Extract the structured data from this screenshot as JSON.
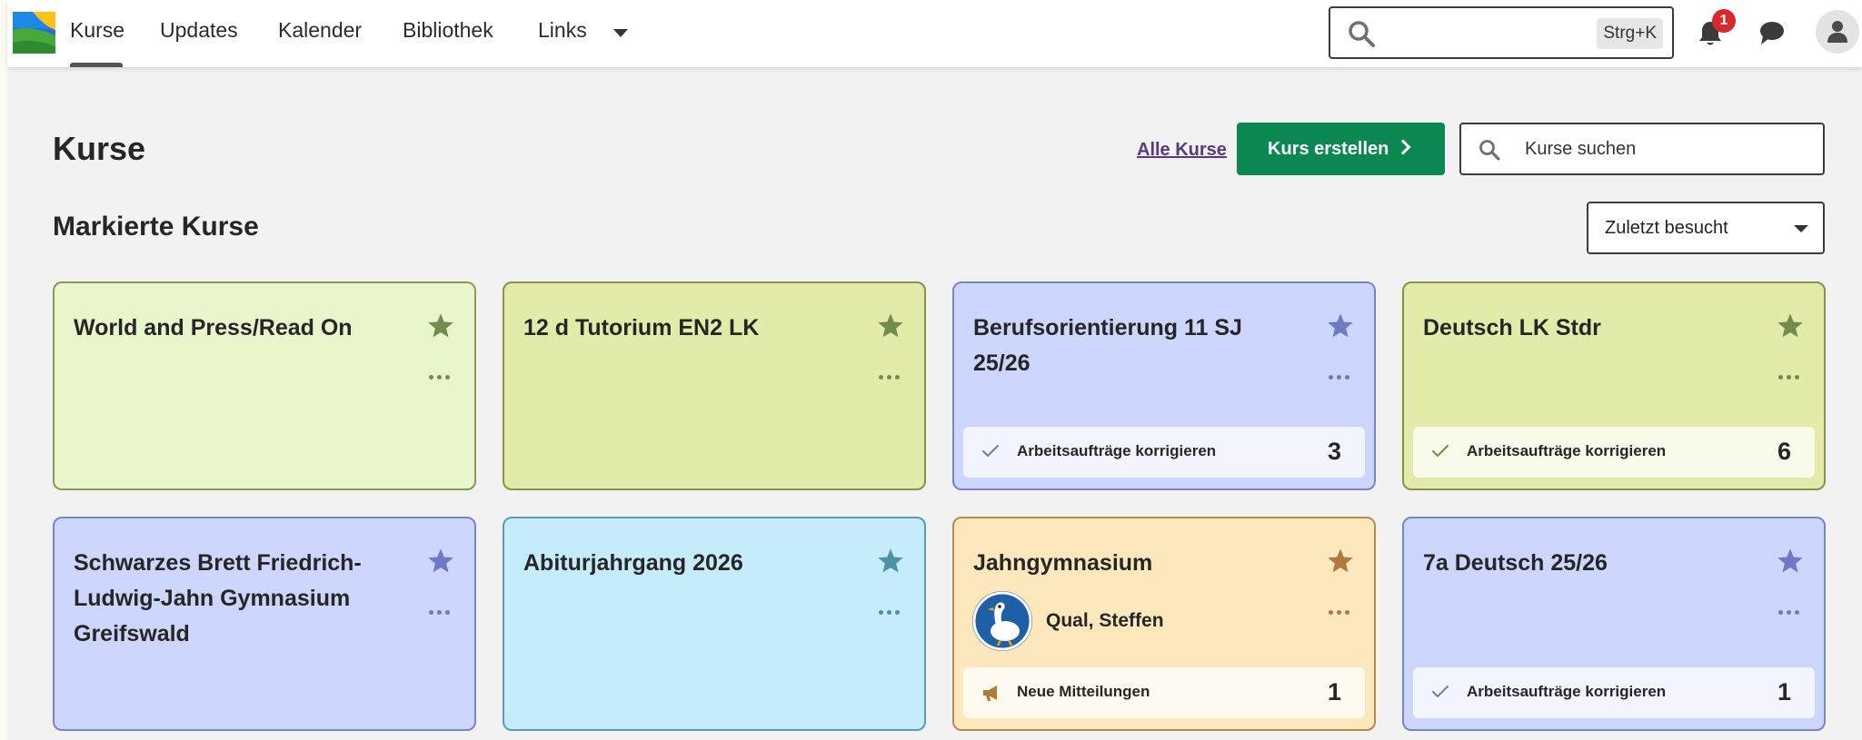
{
  "nav": {
    "items": [
      "Kurse",
      "Updates",
      "Kalender",
      "Bibliothek",
      "Links"
    ],
    "search_shortcut": "Strg+K",
    "notification_count": "1"
  },
  "header": {
    "title": "Kurse",
    "all_courses_link": "Alle Kurse",
    "create_button": "Kurs erstellen",
    "search_placeholder": "Kurse suchen"
  },
  "section": {
    "title": "Markierte Kurse",
    "sort_value": "Zuletzt besucht"
  },
  "colors": {
    "primary": "#0b8751",
    "badge": "#d9292b"
  },
  "cards": [
    {
      "title": "World and Press/Read On",
      "bg": "#e9f6cb",
      "border": "#8a9a55",
      "accent": "#718c4d",
      "icon": "star-icon"
    },
    {
      "title": "12 d Tutorium EN2 LK",
      "bg": "#e4eaaa",
      "border": "#8b9147",
      "accent": "#718c4d",
      "icon": "star-icon"
    },
    {
      "title": "Berufsorientierung 11 SJ 25/26",
      "bg": "#cdd6fd",
      "border": "#7a84c8",
      "accent": "#6d7ac4",
      "icon": "star-icon",
      "todo": {
        "label": "Arbeitsaufträge korrigieren",
        "count": "3",
        "icon": "check-icon",
        "bg": "#f3f5fe"
      }
    },
    {
      "title": "Deutsch LK Stdr",
      "bg": "#e4eaaa",
      "border": "#8b9147",
      "accent": "#718c4d",
      "icon": "star-icon",
      "todo": {
        "label": "Arbeitsaufträge korrigieren",
        "count": "6",
        "icon": "check-icon",
        "bg": "#f8faea"
      }
    },
    {
      "title": "Schwarzes Brett Friedrich-Ludwig-Jahn Gymnasium Greifswald",
      "bg": "#cdd6fd",
      "border": "#7a84c8",
      "accent": "#6d7ac4",
      "icon": "star-icon"
    },
    {
      "title": "Abiturjahrgang 2026",
      "bg": "#c6ebfb",
      "border": "#5d9bb5",
      "accent": "#4a93a1",
      "icon": "star-icon"
    },
    {
      "title": "Jahngymnasium",
      "bg": "#fde8bd",
      "border": "#b78a4e",
      "accent": "#b07a3c",
      "icon": "star-icon",
      "teacher": "Qual, Steffen",
      "todo": {
        "label": "Neue Mitteilungen",
        "count": "1",
        "icon": "megaphone-icon",
        "bg": "#fffaf0"
      }
    },
    {
      "title": "7a Deutsch 25/26",
      "bg": "#cdd6fd",
      "border": "#7a84c8",
      "accent": "#6d7ac4",
      "icon": "star-icon",
      "todo": {
        "label": "Arbeitsaufträge korrigieren",
        "count": "1",
        "icon": "check-icon",
        "bg": "#f3f5fe"
      }
    }
  ]
}
